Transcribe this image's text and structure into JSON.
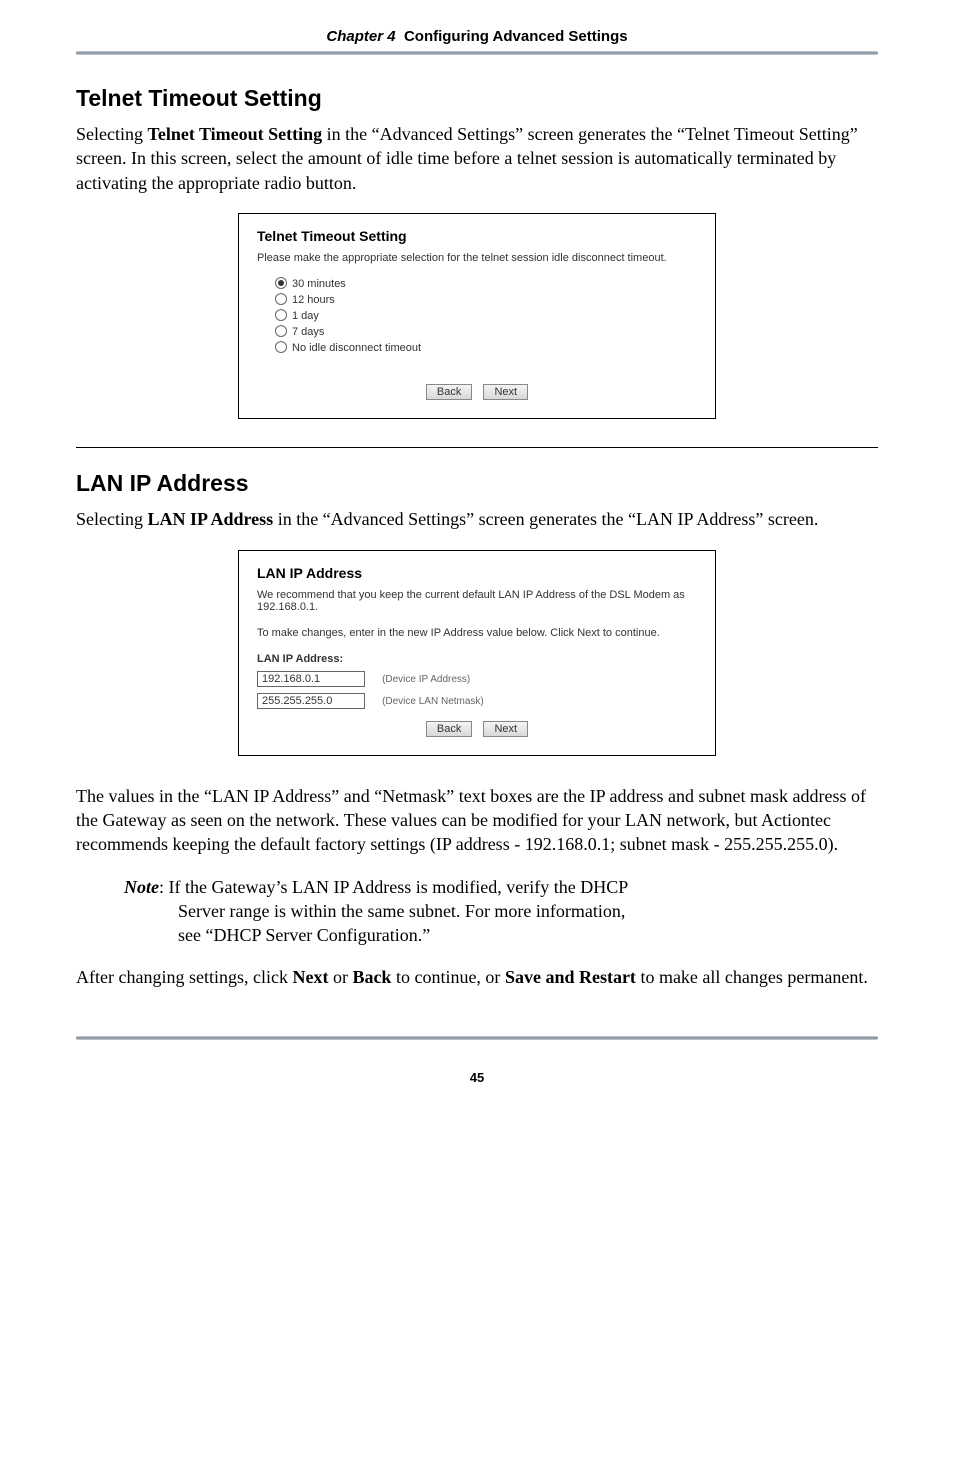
{
  "header": {
    "chapter_prefix": "Chapter 4",
    "chapter_title": "Configuring Advanced Settings"
  },
  "section1": {
    "heading": "Telnet Timeout Setting",
    "intro_part1": "Selecting ",
    "intro_bold": "Telnet Timeout Setting",
    "intro_part2": " in the “Advanced Settings” screen generates the “Telnet Timeout Setting” screen. In this screen, select the amount of idle time before a telnet session is automatically terminated by activating the appropriate radio button."
  },
  "telnet_panel": {
    "title": "Telnet Timeout Setting",
    "blurb": "Please make the appropriate selection for the telnet session idle disconnect timeout.",
    "options": [
      {
        "label": "30 minutes",
        "selected": true
      },
      {
        "label": "12 hours",
        "selected": false
      },
      {
        "label": "1 day",
        "selected": false
      },
      {
        "label": "7 days",
        "selected": false
      },
      {
        "label": "No idle disconnect timeout",
        "selected": false
      }
    ],
    "back_label": "Back",
    "next_label": "Next"
  },
  "section2": {
    "heading": "LAN IP Address",
    "intro_part1": "Selecting ",
    "intro_bold": "LAN IP Address",
    "intro_part2": " in the “Advanced Settings” screen generates the “",
    "intro_sc": "LAN IP",
    "intro_part3": " Address” screen."
  },
  "lan_panel": {
    "title": "LAN IP Address",
    "blurb1": "We recommend that you keep the current default LAN IP Address of the DSL Modem as 192.168.0.1.",
    "blurb2": "To make changes, enter in the new IP Address value below. Click Next to continue.",
    "subhead": "LAN IP Address:",
    "ip_value": "192.168.0.1",
    "ip_caption": "(Device IP Address)",
    "mask_value": "255.255.255.0",
    "mask_caption": "(Device LAN Netmask)",
    "back_label": "Back",
    "next_label": "Next"
  },
  "para_after_lan": "The values in the “LAN IP Address” and “Netmask” text boxes are the IP address and subnet mask address of the Gateway as seen on the network. These values can be modified for your LAN network, but Actiontec recommends keeping the default factory settings (IP address - 192.168.0.1; subnet mask - 255.255.255.0).",
  "note": {
    "label": "Note",
    "line1": ": If the Gateway’s LAN IP Address is modified, verify the DHCP",
    "line2": "Server range is within the same subnet. For more information,",
    "line3": "see “DHCP Server Configuration.”"
  },
  "closing": {
    "part1": "After changing settings, click ",
    "bold1": "Next",
    "part2": " or ",
    "bold2": "Back",
    "part3": " to continue, or ",
    "bold3": "Save and Restart",
    "part4": " to make all changes permanent."
  },
  "page_number": "45"
}
